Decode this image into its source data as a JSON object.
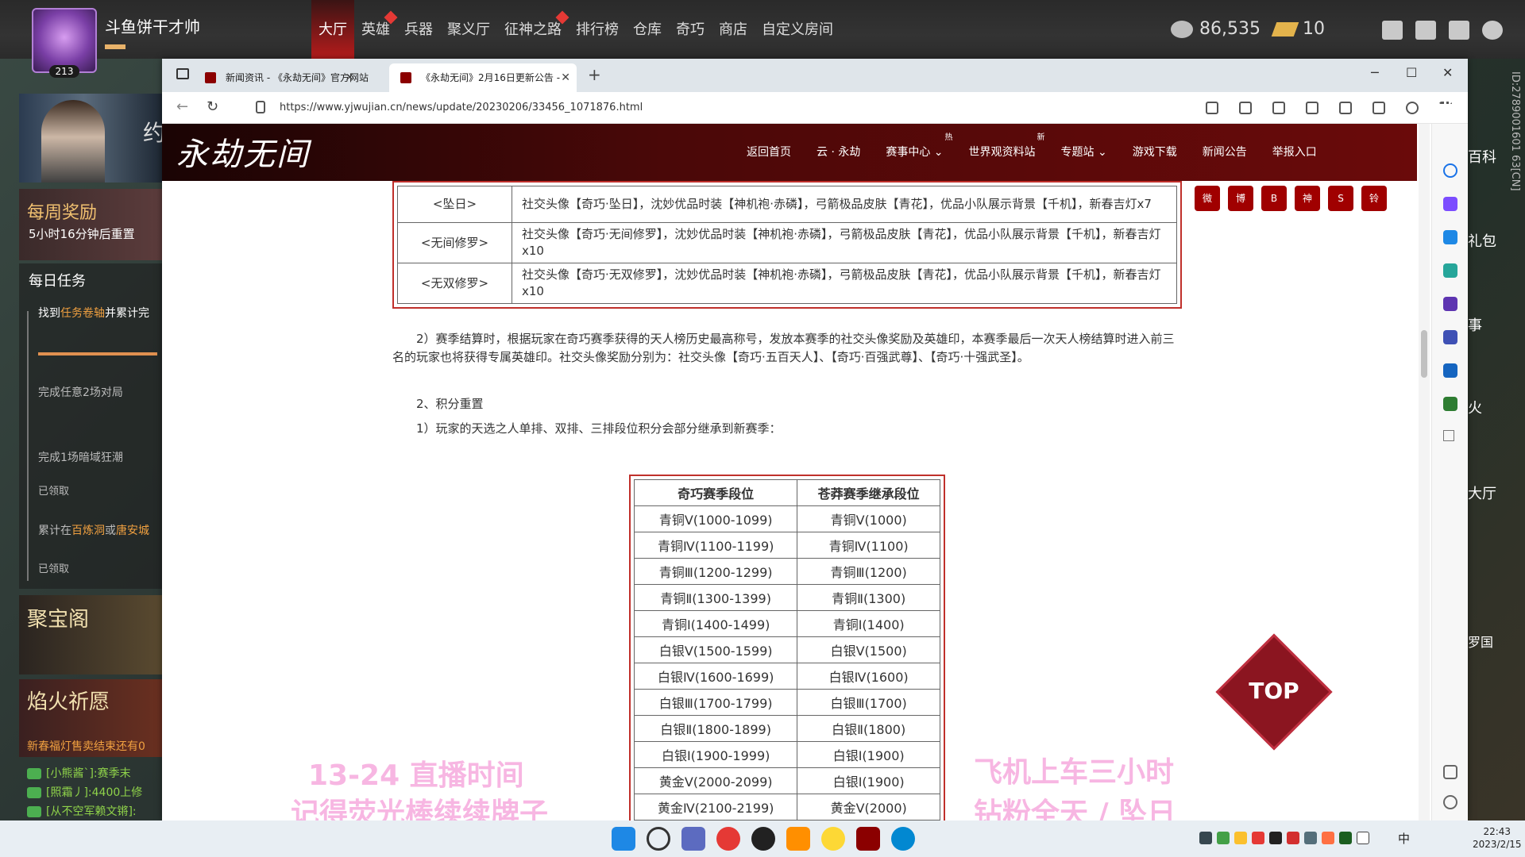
{
  "game": {
    "player": {
      "name": "斗鱼饼干才帅",
      "level": "213"
    },
    "nav": [
      {
        "label": "大厅",
        "active": true
      },
      {
        "label": "英雄",
        "dot": true
      },
      {
        "label": "兵器"
      },
      {
        "label": "聚义厅"
      },
      {
        "label": "征神之路",
        "dot": true
      },
      {
        "label": "排行榜"
      },
      {
        "label": "仓库"
      },
      {
        "label": "奇巧"
      },
      {
        "label": "商店"
      },
      {
        "label": "自定义房间"
      }
    ],
    "currency": {
      "silver": "86,535",
      "gold": "10"
    },
    "hero_char": "约",
    "weekly": {
      "title": "每周奖励",
      "subtitle": "5小时16分钟后重置"
    },
    "daily": {
      "title": "每日任务",
      "task1_pre": "找到",
      "task1_hl": "任务卷轴",
      "task1_post": "并累计完",
      "task2": "完成任意2场对局",
      "task3": "完成1场暗域狂潮",
      "task3_status": "已领取",
      "task4_pre": "累计在",
      "task4_hl": "百炼洞",
      "task4_mid": "或",
      "task4_hl2": "唐安城",
      "task4_status": "已领取"
    },
    "jubao": "聚宝阁",
    "yanhuo": {
      "title": "焰火祈愿",
      "sub": "新春福灯售卖结束还有0"
    },
    "chat": [
      "[小熊酱`]:赛季末",
      "[照霜丿]:4400上修",
      "[从不空军赖文锵]:"
    ],
    "right_labels": [
      "百科",
      "礼包",
      "事",
      "火",
      "大厅",
      "罗国"
    ],
    "id_text": "ID:2789001601 63[CN]"
  },
  "browser": {
    "tabs": [
      {
        "label": "新闻资讯 - 《永劫无间》官方网站"
      },
      {
        "label": "《永劫无间》2月16日更新公告 -",
        "active": true
      }
    ],
    "url": "https://www.yjwujian.cn/news/update/20230206/33456_1071876.html"
  },
  "site": {
    "logo": "永劫无间",
    "menu": [
      {
        "label": "返回首页"
      },
      {
        "label": "云 · 永劫"
      },
      {
        "label": "赛事中心 ⌄",
        "badge": "热"
      },
      {
        "label": "世界观资料站",
        "badge": "新"
      },
      {
        "label": "专题站 ⌄"
      },
      {
        "label": "游戏下载"
      },
      {
        "label": "新闻公告"
      },
      {
        "label": "举报入口"
      }
    ],
    "social": [
      "微",
      "博",
      "B",
      "神",
      "S",
      "铃"
    ],
    "reward_rows": [
      {
        "k": "<坠日>",
        "v": "社交头像【奇巧·坠日】，沈妙优品时装【神机袍·赤磷】，弓箭极品皮肤【青花】，优品小队展示背景【千机】，新春吉灯x7"
      },
      {
        "k": "<无间修罗>",
        "v": "社交头像【奇巧·无间修罗】，沈妙优品时装【神机袍·赤磷】，弓箭极品皮肤【青花】，优品小队展示背景【千机】，新春吉灯x10"
      },
      {
        "k": "<无双修罗>",
        "v": "社交头像【奇巧·无双修罗】，沈妙优品时装【神机袍·赤磷】，弓箭极品皮肤【青花】，优品小队展示背景【千机】，新春吉灯x10"
      }
    ],
    "para1": "　　2）赛季结算时，根据玩家在奇巧赛季获得的天人榜历史最高称号，发放本赛季的社交头像奖励及英雄印，本赛季最后一次天人榜结算时进入前三名的玩家也将获得专属英雄印。社交头像奖励分别为：社交头像【奇巧·五百天人】、【奇巧·百强武尊】、【奇巧·十强武圣】。",
    "para2": "　　2、积分重置",
    "para3": "　　1）玩家的天选之人单排、双排、三排段位积分会部分继承到新赛季：",
    "rank_head": [
      "奇巧赛季段位",
      "苍莽赛季继承段位"
    ],
    "rank_rows": [
      [
        "青铜Ⅴ(1000-1099)",
        "青铜Ⅴ(1000)"
      ],
      [
        "青铜Ⅳ(1100-1199)",
        "青铜Ⅳ(1100)"
      ],
      [
        "青铜Ⅲ(1200-1299)",
        "青铜Ⅲ(1200)"
      ],
      [
        "青铜Ⅱ(1300-1399)",
        "青铜Ⅱ(1300)"
      ],
      [
        "青铜Ⅰ(1400-1499)",
        "青铜Ⅰ(1400)"
      ],
      [
        "白银Ⅴ(1500-1599)",
        "白银Ⅴ(1500)"
      ],
      [
        "白银Ⅳ(1600-1699)",
        "白银Ⅳ(1600)"
      ],
      [
        "白银Ⅲ(1700-1799)",
        "白银Ⅲ(1700)"
      ],
      [
        "白银Ⅱ(1800-1899)",
        "白银Ⅱ(1800)"
      ],
      [
        "白银Ⅰ(1900-1999)",
        "白银Ⅰ(1900)"
      ],
      [
        "黄金Ⅴ(2000-2099)",
        "白银Ⅰ(1900)"
      ],
      [
        "黄金Ⅳ(2100-2199)",
        "黄金Ⅴ(2000)"
      ]
    ],
    "top_label": "TOP"
  },
  "overlay": {
    "left1": "13-24  直播时间",
    "left2": "记得荧光棒续续牌子",
    "right1": "飞机上车三小时",
    "right2": "钻粉全天 / 坠日"
  },
  "taskbar": {
    "ime": "中",
    "time": "22:43",
    "date": "2023/2/15"
  }
}
